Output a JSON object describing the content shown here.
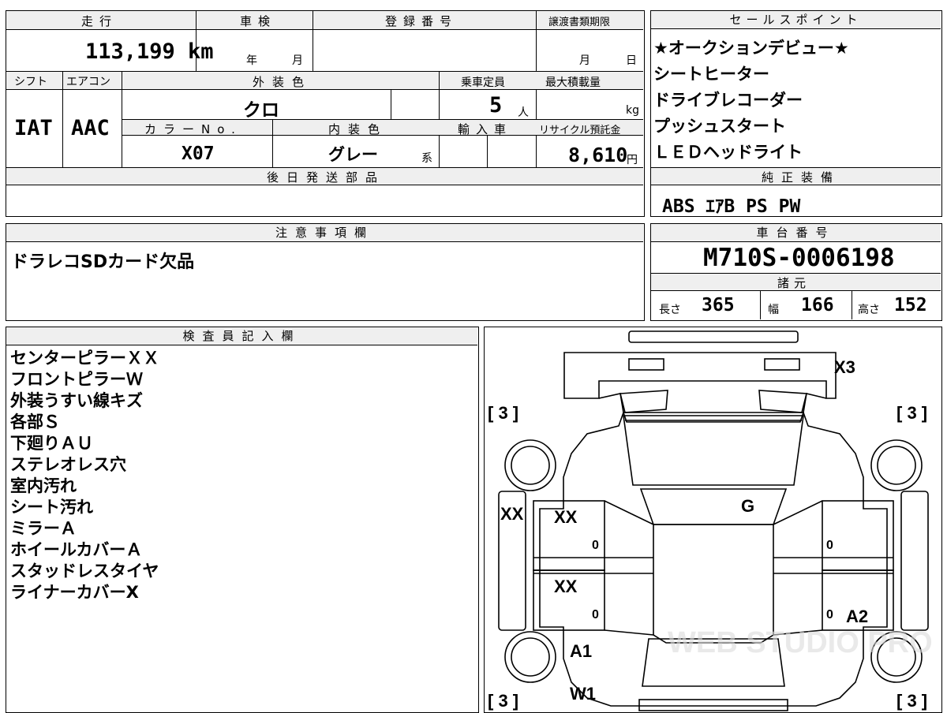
{
  "top_table": {
    "mileage_label": "走行",
    "mileage_value": "113,199 km",
    "inspection_label": "車検",
    "inspection_year_unit": "年",
    "inspection_month_unit": "月",
    "registration_label": "登録番号",
    "registration_value": "",
    "transfer_doc_label": "譲渡書類期限",
    "transfer_month_unit": "月",
    "transfer_day_unit": "日",
    "shift_label": "シフト",
    "shift_value": "IAT",
    "aircon_label": "エアコン",
    "aircon_value": "AAC",
    "exterior_color_label": "外装色",
    "exterior_color_value": "クロ",
    "capacity_label": "乗車定員",
    "capacity_value": "5",
    "capacity_unit": "人",
    "max_load_label": "最大積載量",
    "max_load_unit": "kg",
    "color_no_label": "カラーNo.",
    "color_no_value": "X07",
    "interior_color_label": "内装色",
    "interior_color_value": "グレー",
    "interior_color_suffix": "系",
    "import_label": "輸入車",
    "recycle_label": "リサイクル預託金",
    "recycle_value": "8,610",
    "recycle_unit": "円",
    "later_parts_label": "後日発送部品"
  },
  "sales_points": {
    "label": "セールスポイント",
    "items": [
      "★オークションデビュー★",
      "シートヒーター",
      "ドライブレコーダー",
      "プッシュスタート",
      "ＬＥＤヘッドライト"
    ]
  },
  "genuine_equipment": {
    "label": "純正装備",
    "value": "ABS ｴｱB PS PW"
  },
  "notes": {
    "label": "注意事項欄",
    "value": "ドラレコSDカード欠品"
  },
  "chassis": {
    "label": "車台番号",
    "value": "M710S-0006198",
    "spec_label": "諸元",
    "length_label": "長さ",
    "length_value": "365",
    "width_label": "幅",
    "width_value": "166",
    "height_label": "高さ",
    "height_value": "152"
  },
  "inspector": {
    "label": "検査員記入欄",
    "items": [
      "センターピラーＸＸ",
      "フロントピラーＷ",
      "外装うすい線キズ",
      "各部Ｓ",
      "下廻りＡＵ",
      "ステレオレス穴",
      "室内汚れ",
      "シート汚れ",
      "ミラーＡ",
      "ホイールカバーＡ",
      "スタッドレスタイヤ",
      "ライナーカバーX"
    ]
  },
  "diagram": {
    "tire_tread_fl": "[ 3 ]",
    "tire_tread_fr": "[ 3 ]",
    "tire_tread_rl": "[ 3 ]",
    "tire_tread_rr": "[ 3 ]",
    "rear_mark": "X3",
    "left_pillar_mark": "XX",
    "left_front_door": "XX",
    "left_rear_door": "XX",
    "roof_mark": "G",
    "right_rear_quarter": "A2",
    "left_rear_quarter": "A1",
    "front_mark": "W1",
    "door_small_1": "0",
    "door_small_2": "0",
    "door_small_3": "0",
    "door_small_4": "0",
    "watermark": "WEB STUDIO PRO"
  }
}
